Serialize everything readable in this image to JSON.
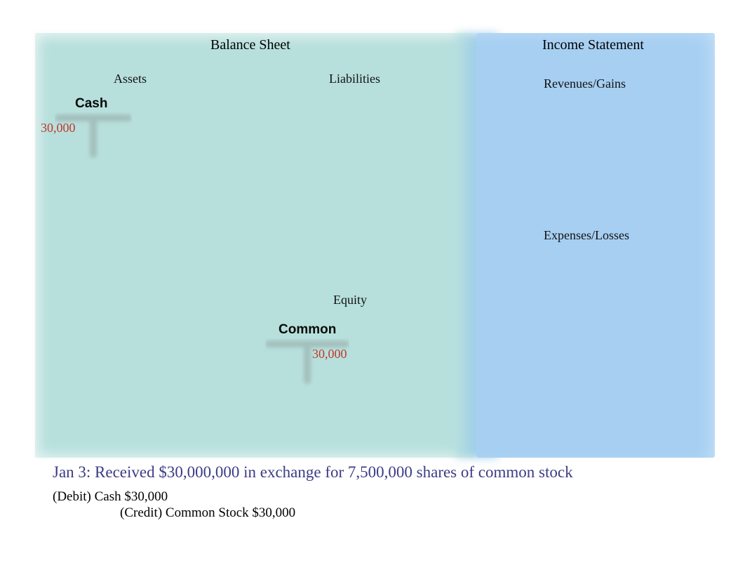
{
  "balance_sheet": {
    "title": "Balance Sheet",
    "assets": {
      "label": "Assets",
      "accounts": {
        "cash": {
          "name": "Cash",
          "debit": "30,000"
        }
      }
    },
    "liabilities": {
      "label": "Liabilities"
    },
    "equity": {
      "label": "Equity",
      "accounts": {
        "common_stock": {
          "name": "Common",
          "credit": "30,000"
        }
      }
    }
  },
  "income_statement": {
    "title": "Income Statement",
    "revenues": {
      "label": "Revenues/Gains"
    },
    "expenses": {
      "label": "Expenses/Losses"
    }
  },
  "transaction": {
    "description": "Jan 3: Received $30,000,000 in exchange for 7,500,000 shares of common stock",
    "journal": {
      "debit_line": "(Debit) Cash $30,000",
      "credit_line": "(Credit) Common Stock $30,000"
    }
  },
  "colors": {
    "balance_panel": "#b7e0dd",
    "income_panel": "#a6cff2",
    "amount": "#c0392b",
    "transaction": "#3c3b85"
  }
}
